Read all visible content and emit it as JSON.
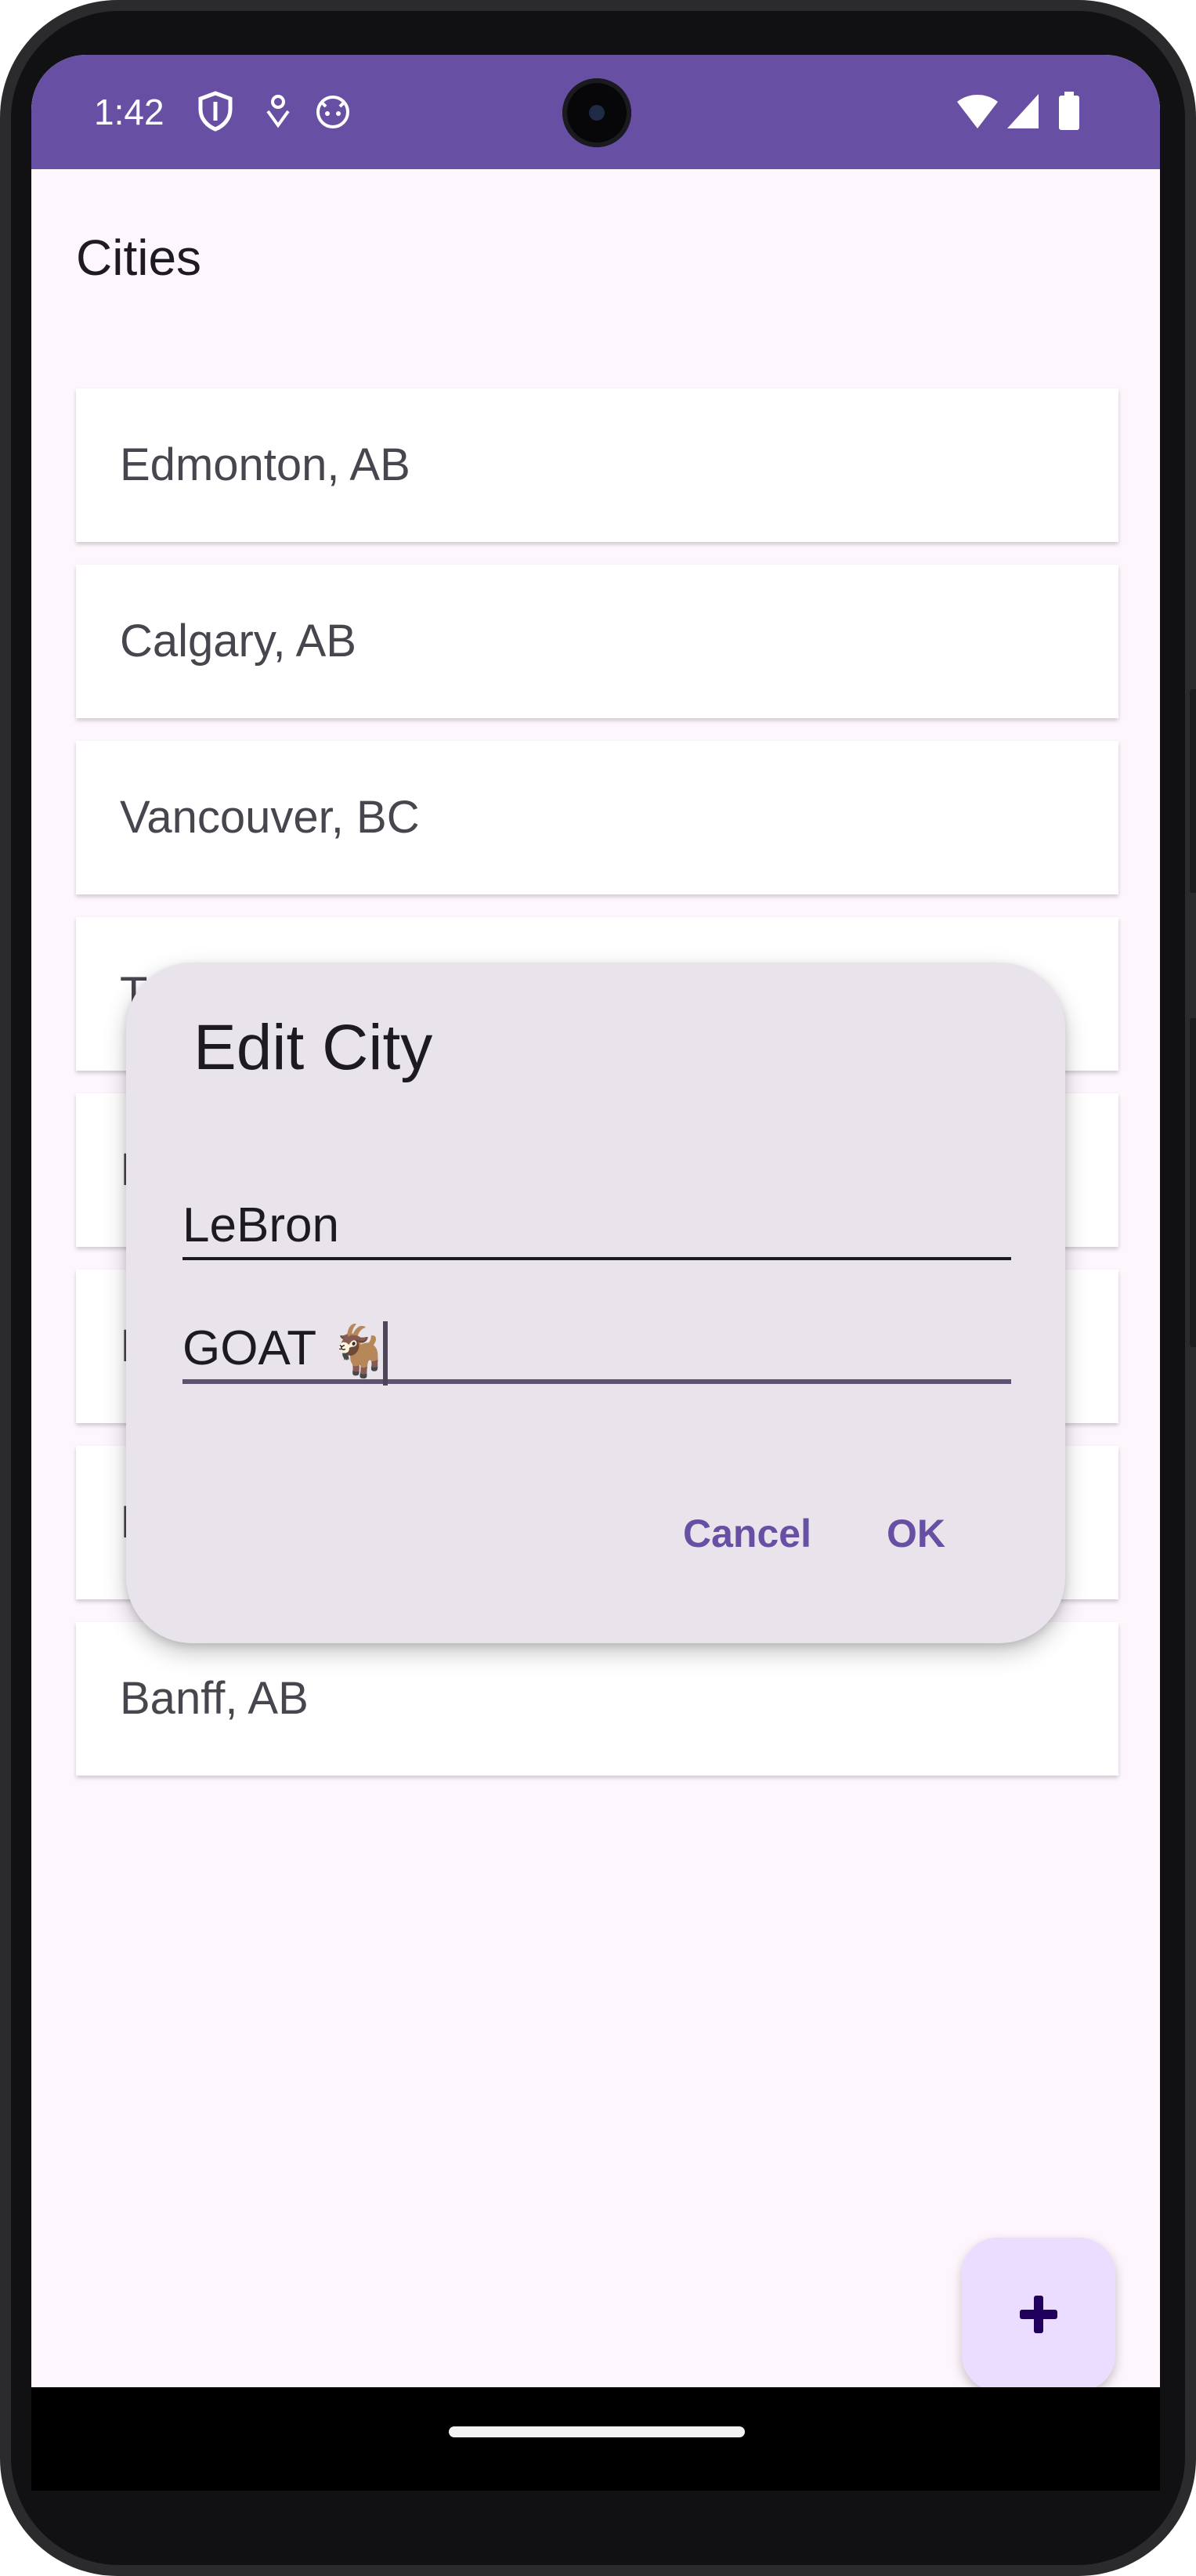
{
  "status_bar": {
    "time": "1:42",
    "icons": [
      "shield-icon",
      "location-pin-icon",
      "android-face-icon"
    ],
    "right_icons": [
      "wifi-icon",
      "cellular-signal-icon",
      "battery-icon"
    ],
    "color": "#6750a4"
  },
  "app": {
    "title": "Cities",
    "cities": [
      "Edmonton, AB",
      "Calgary, AB",
      "Vancouver, BC",
      "T",
      "I",
      "I",
      "I",
      "Banff, AB"
    ]
  },
  "dialog": {
    "title": "Edit City",
    "name_value": "LeBron",
    "province_value": "GOAT ",
    "province_emoji": "🐐",
    "cancel_label": "Cancel",
    "ok_label": "OK"
  },
  "fab": {
    "icon": "plus-icon",
    "color": "#eaddff"
  }
}
